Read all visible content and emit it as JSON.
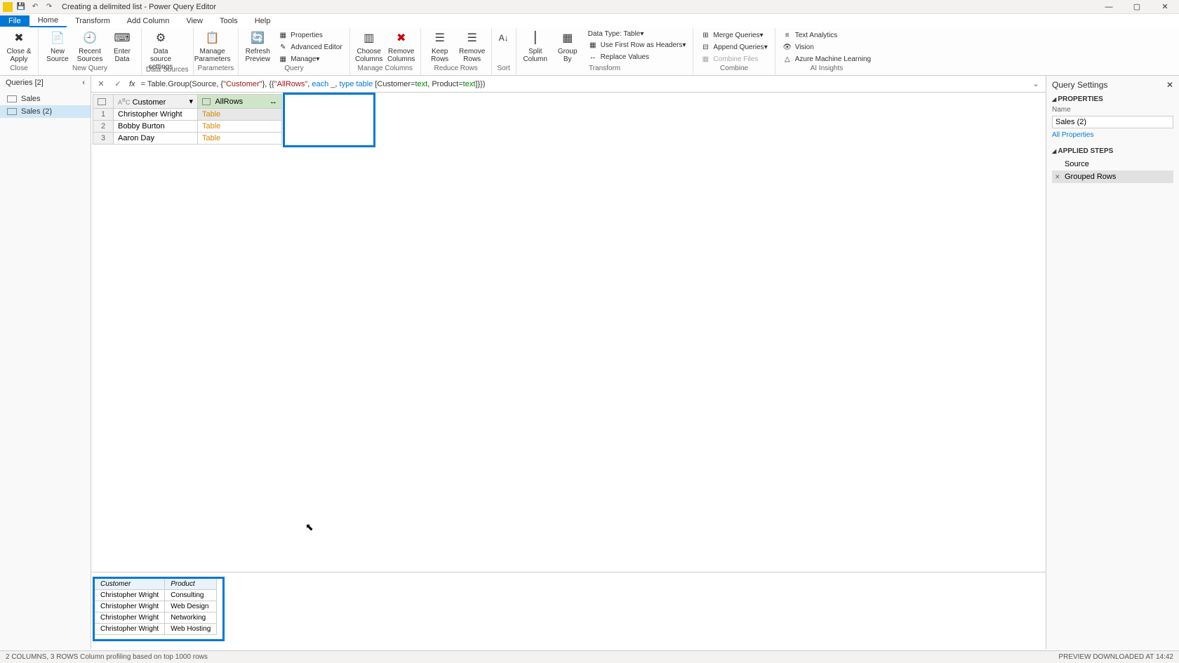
{
  "title": "Creating a delimited list - Power Query Editor",
  "menu": {
    "file": "File",
    "home": "Home",
    "transform": "Transform",
    "addcol": "Add Column",
    "view": "View",
    "tools": "Tools",
    "help": "Help"
  },
  "ribbon": {
    "close": {
      "label": "Close & Apply",
      "group": "Close"
    },
    "newquery": {
      "newsource": "New Source",
      "recent": "Recent Sources",
      "enter": "Enter Data",
      "group": "New Query"
    },
    "datasources": {
      "settings": "Data source settings",
      "group": "Data Sources"
    },
    "parameters": {
      "manage": "Manage Parameters",
      "group": "Parameters"
    },
    "query": {
      "refresh": "Refresh Preview",
      "props": "Properties",
      "adv": "Advanced Editor",
      "manage": "Manage",
      "group": "Query"
    },
    "managecols": {
      "choose": "Choose Columns",
      "remove": "Remove Columns",
      "group": "Manage Columns"
    },
    "reducerows": {
      "keep": "Keep Rows",
      "remove": "Remove Rows",
      "group": "Reduce Rows"
    },
    "sort": {
      "group": "Sort"
    },
    "transform": {
      "split": "Split Column",
      "groupby": "Group By",
      "datatype": "Data Type: Table",
      "firstrow": "Use First Row as Headers",
      "replace": "Replace Values",
      "group": "Transform"
    },
    "combine": {
      "merge": "Merge Queries",
      "append": "Append Queries",
      "combinefiles": "Combine Files",
      "group": "Combine"
    },
    "ai": {
      "text": "Text Analytics",
      "vision": "Vision",
      "ml": "Azure Machine Learning",
      "group": "AI Insights"
    }
  },
  "queries": {
    "header": "Queries [2]",
    "items": [
      {
        "name": "Sales"
      },
      {
        "name": "Sales (2)"
      }
    ]
  },
  "formula": {
    "prefix": "= Table.Group(Source, {",
    "customerKey": "\"Customer\"",
    "mid1": "}, {{",
    "allrowsKey": "\"AllRows\"",
    "mid2": ", ",
    "each": "each",
    "mid3": " _, ",
    "type": "type",
    "mid4": " ",
    "table": "table",
    "mid5": " [Customer=",
    "text1": "text",
    "mid6": ", Product=",
    "text2": "text",
    "suffix": "]}})"
  },
  "datatable": {
    "col1": "Customer",
    "col2": "AllRows",
    "rows": [
      {
        "n": "1",
        "customer": "Christopher Wright",
        "allrows": "Table"
      },
      {
        "n": "2",
        "customer": "Bobby Burton",
        "allrows": "Table"
      },
      {
        "n": "3",
        "customer": "Aaron Day",
        "allrows": "Table"
      }
    ]
  },
  "preview": {
    "col1": "Customer",
    "col2": "Product",
    "rows": [
      {
        "c": "Christopher Wright",
        "p": "Consulting"
      },
      {
        "c": "Christopher Wright",
        "p": "Web Design"
      },
      {
        "c": "Christopher Wright",
        "p": "Networking"
      },
      {
        "c": "Christopher Wright",
        "p": "Web Hosting"
      }
    ]
  },
  "settings": {
    "title": "Query Settings",
    "properties": "PROPERTIES",
    "nameLabel": "Name",
    "nameValue": "Sales (2)",
    "allprops": "All Properties",
    "applied": "APPLIED STEPS",
    "steps": [
      {
        "name": "Source"
      },
      {
        "name": "Grouped Rows"
      }
    ]
  },
  "status": {
    "left": "2 COLUMNS, 3 ROWS    Column profiling based on top 1000 rows",
    "right": "PREVIEW DOWNLOADED AT 14:42"
  }
}
